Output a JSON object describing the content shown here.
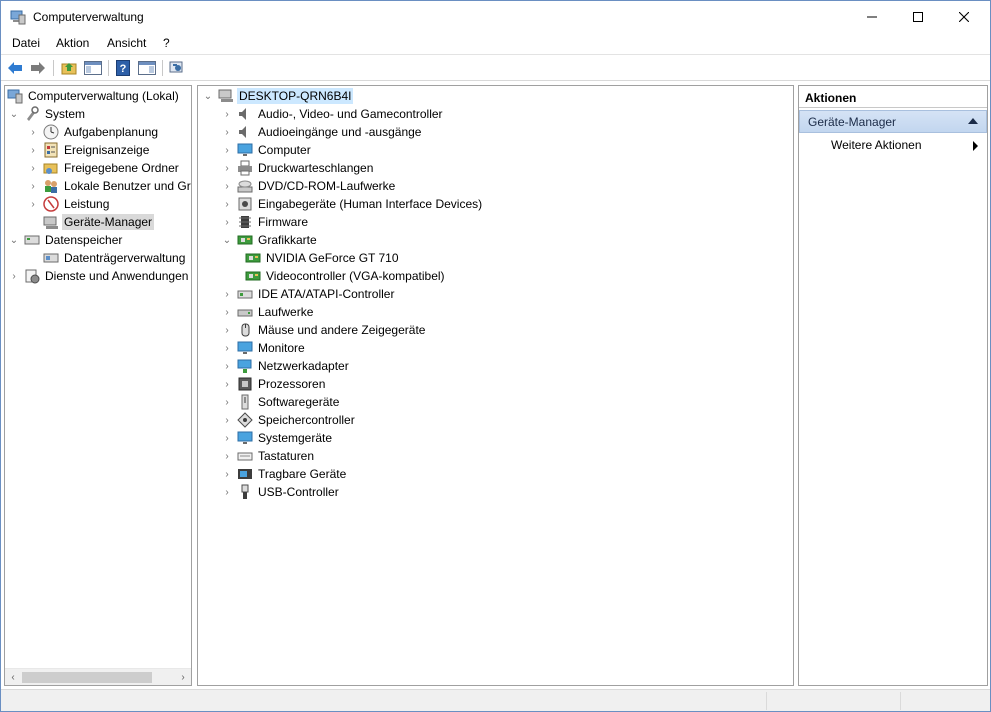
{
  "window": {
    "title": "Computerverwaltung",
    "controls": [
      "minimize",
      "maximize",
      "close"
    ]
  },
  "menu": [
    {
      "label": "Datei"
    },
    {
      "label": "Aktion"
    },
    {
      "label": "Ansicht"
    },
    {
      "label": "?"
    }
  ],
  "toolbar": {
    "buttons": [
      "back-arrow-icon",
      "forward-arrow-icon",
      "up-folder-icon",
      "show-hide-console-tree-icon",
      "help-icon",
      "show-hide-action-pane-icon",
      "properties-icon"
    ]
  },
  "left_tree": {
    "root": "Computerverwaltung (Lokal)",
    "items": [
      {
        "label": "System",
        "level": 1,
        "expanded": true,
        "icon": "tools-icon"
      },
      {
        "label": "Aufgabenplanung",
        "level": 2,
        "expanded": false,
        "icon": "clock-icon"
      },
      {
        "label": "Ereignisanzeige",
        "level": 2,
        "expanded": false,
        "icon": "event-viewer-icon"
      },
      {
        "label": "Freigegebene Ordner",
        "level": 2,
        "expanded": false,
        "icon": "shared-folder-icon"
      },
      {
        "label": "Lokale Benutzer und Gru",
        "level": 2,
        "expanded": false,
        "icon": "users-icon"
      },
      {
        "label": "Leistung",
        "level": 2,
        "expanded": false,
        "icon": "performance-icon"
      },
      {
        "label": "Geräte-Manager",
        "level": 2,
        "selected": true,
        "icon": "device-manager-icon"
      },
      {
        "label": "Datenspeicher",
        "level": 1,
        "expanded": true,
        "icon": "storage-icon"
      },
      {
        "label": "Datenträgerverwaltung",
        "level": 2,
        "icon": "disk-management-icon"
      },
      {
        "label": "Dienste und Anwendungen",
        "level": 1,
        "expanded": false,
        "icon": "services-icon"
      }
    ]
  },
  "device_tree": {
    "root": "DESKTOP-QRN6B4I",
    "items": [
      {
        "label": "Audio-, Video- und Gamecontroller",
        "level": 1,
        "expanded": false,
        "icon": "speaker-icon"
      },
      {
        "label": "Audioeingänge und -ausgänge",
        "level": 1,
        "expanded": false,
        "icon": "speaker-icon"
      },
      {
        "label": "Computer",
        "level": 1,
        "expanded": false,
        "icon": "monitor-icon"
      },
      {
        "label": "Druckwarteschlangen",
        "level": 1,
        "expanded": false,
        "icon": "printer-icon"
      },
      {
        "label": "DVD/CD-ROM-Laufwerke",
        "level": 1,
        "expanded": false,
        "icon": "disc-drive-icon"
      },
      {
        "label": "Eingabegeräte (Human Interface Devices)",
        "level": 1,
        "expanded": false,
        "icon": "hid-icon"
      },
      {
        "label": "Firmware",
        "level": 1,
        "expanded": false,
        "icon": "chip-icon"
      },
      {
        "label": "Grafikkarte",
        "level": 1,
        "expanded": true,
        "icon": "graphics-card-icon"
      },
      {
        "label": "NVIDIA GeForce GT 710",
        "level": 2,
        "icon": "graphics-card-icon"
      },
      {
        "label": "Videocontroller (VGA-kompatibel)",
        "level": 2,
        "icon": "graphics-card-icon"
      },
      {
        "label": "IDE ATA/ATAPI-Controller",
        "level": 1,
        "expanded": false,
        "icon": "ide-controller-icon"
      },
      {
        "label": "Laufwerke",
        "level": 1,
        "expanded": false,
        "icon": "drive-icon"
      },
      {
        "label": "Mäuse und andere Zeigegeräte",
        "level": 1,
        "expanded": false,
        "icon": "mouse-icon"
      },
      {
        "label": "Monitore",
        "level": 1,
        "expanded": false,
        "icon": "monitor-icon"
      },
      {
        "label": "Netzwerkadapter",
        "level": 1,
        "expanded": false,
        "icon": "network-icon"
      },
      {
        "label": "Prozessoren",
        "level": 1,
        "expanded": false,
        "icon": "processor-icon"
      },
      {
        "label": "Softwaregeräte",
        "level": 1,
        "expanded": false,
        "icon": "software-device-icon"
      },
      {
        "label": "Speichercontroller",
        "level": 1,
        "expanded": false,
        "icon": "storage-controller-icon"
      },
      {
        "label": "Systemgeräte",
        "level": 1,
        "expanded": false,
        "icon": "monitor-icon"
      },
      {
        "label": "Tastaturen",
        "level": 1,
        "expanded": false,
        "icon": "keyboard-icon"
      },
      {
        "label": "Tragbare Geräte",
        "level": 1,
        "expanded": false,
        "icon": "portable-device-icon"
      },
      {
        "label": "USB-Controller",
        "level": 1,
        "expanded": false,
        "icon": "usb-icon"
      }
    ]
  },
  "actions": {
    "header": "Aktionen",
    "section": "Geräte-Manager",
    "item": "Weitere Aktionen"
  },
  "colors": {
    "selection_blue": "#cce8ff",
    "selection_gray": "#d9d9d9",
    "section_header": "#c8d9f0",
    "window_border": "#6a8fc2"
  }
}
